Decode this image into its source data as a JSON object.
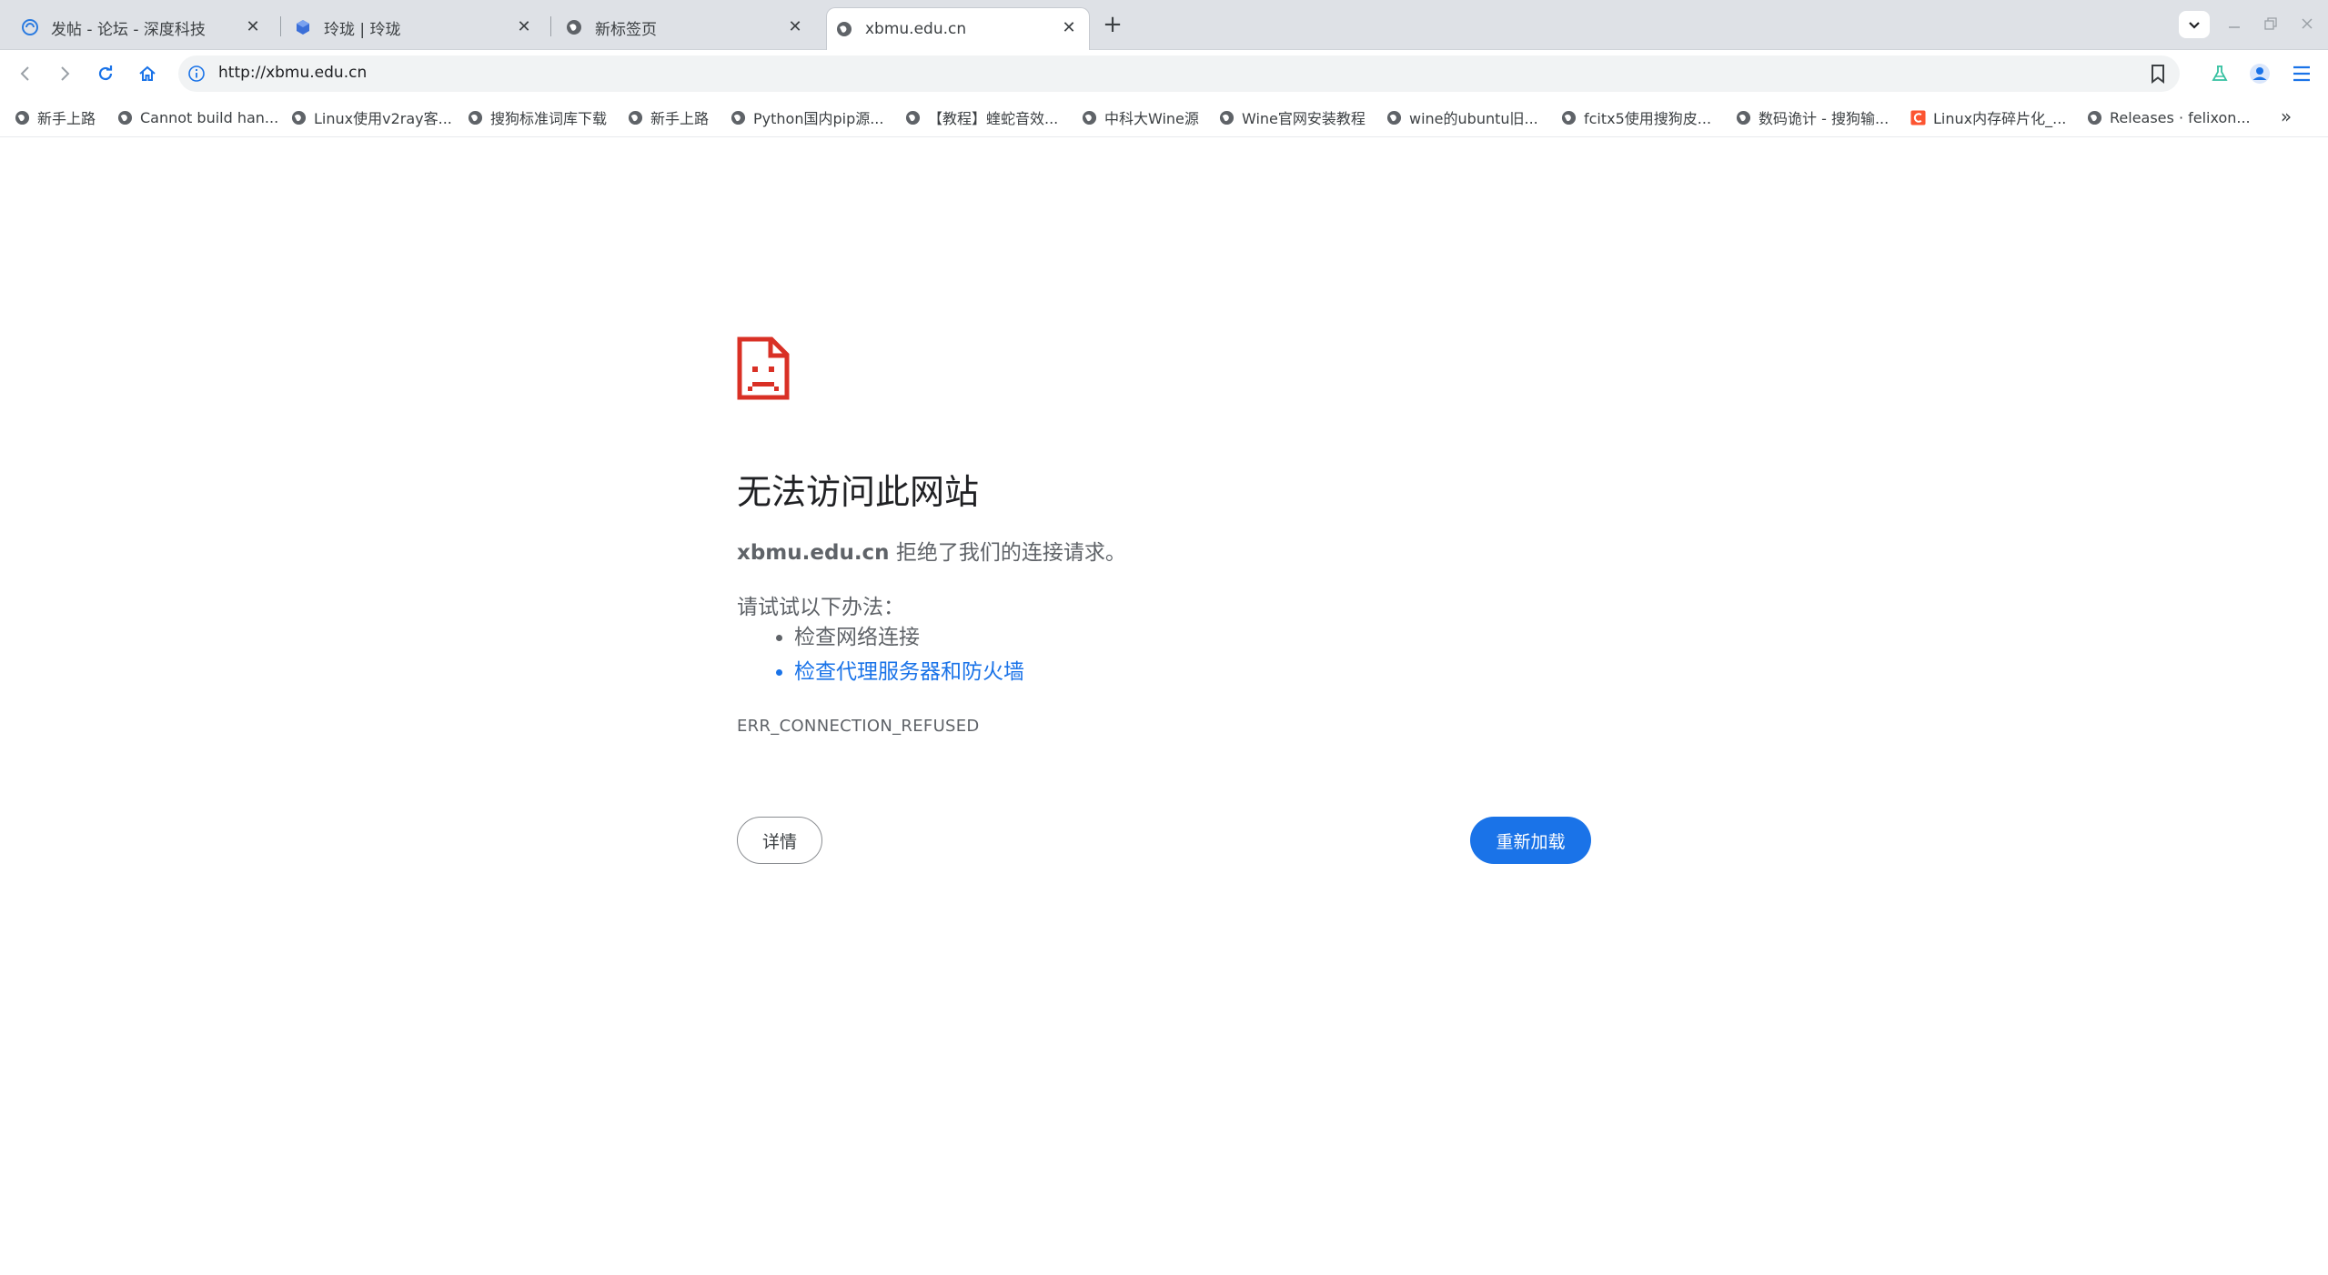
{
  "tabs": [
    {
      "title": "发帖 - 论坛 - 深度科技",
      "icon": "deepin-swirl-icon"
    },
    {
      "title": "玲珑 | 玲珑",
      "icon": "linglong-cube-icon"
    },
    {
      "title": "新标签页",
      "icon": "globe-icon"
    },
    {
      "title": "xbmu.edu.cn",
      "icon": "globe-icon",
      "active": true
    }
  ],
  "tab_close_glyph": "✕",
  "new_tab_glyph": "+",
  "omnibox": {
    "url": "http://xbmu.edu.cn"
  },
  "bookmarks": [
    {
      "label": "新手上路",
      "icon": "globe-icon"
    },
    {
      "label": "Cannot build han...",
      "icon": "globe-icon"
    },
    {
      "label": "Linux使用v2ray客...",
      "icon": "globe-icon"
    },
    {
      "label": "搜狗标准词库下载",
      "icon": "globe-icon"
    },
    {
      "label": "新手上路",
      "icon": "globe-icon"
    },
    {
      "label": "Python国内pip源...",
      "icon": "globe-icon"
    },
    {
      "label": "【教程】蝰蛇音效...",
      "icon": "globe-icon"
    },
    {
      "label": "中科大Wine源",
      "icon": "globe-icon"
    },
    {
      "label": "Wine官网安装教程",
      "icon": "globe-icon"
    },
    {
      "label": "wine的ubuntu旧...",
      "icon": "globe-icon"
    },
    {
      "label": "fcitx5使用搜狗皮...",
      "icon": "globe-icon"
    },
    {
      "label": "数码诡计 - 搜狗输...",
      "icon": "globe-icon"
    },
    {
      "label": "Linux内存碎片化_...",
      "icon": "csdn-icon"
    },
    {
      "label": "Releases · felixon...",
      "icon": "globe-icon"
    }
  ],
  "bookmarks_overflow": "»",
  "error": {
    "title": "无法访问此网站",
    "host": "xbmu.edu.cn",
    "desc_suffix": " 拒绝了我们的连接请求。",
    "try_heading": "请试试以下办法：",
    "suggestions": [
      "检查网络连接",
      "检查代理服务器和防火墙"
    ],
    "code": "ERR_CONNECTION_REFUSED",
    "details_label": "详情",
    "reload_label": "重新加载"
  },
  "colors": {
    "accent": "#1a73e8",
    "error_icon": "#d93025",
    "tabstrip": "#dee1e6"
  }
}
